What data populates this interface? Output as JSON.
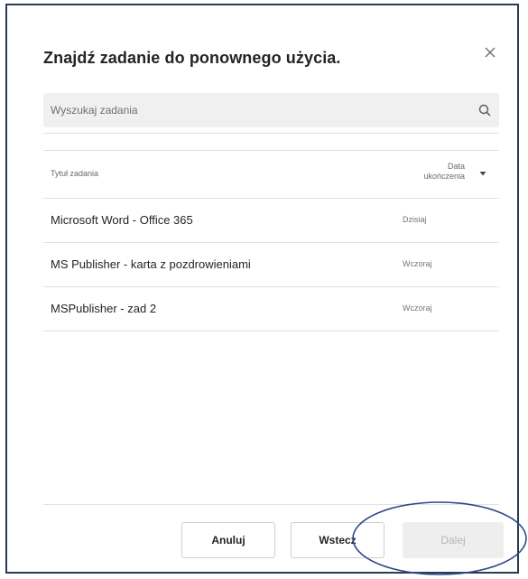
{
  "dialog": {
    "title": "Znajdź zadanie do ponownego użycia.",
    "close_icon": "close-icon"
  },
  "search": {
    "placeholder": "Wyszukaj zadania",
    "icon": "search-icon"
  },
  "table": {
    "columns": {
      "title": "Tytuł zadania",
      "date_line1": "Data",
      "date_line2": "ukończenia",
      "sort_icon": "caret-down-icon"
    },
    "rows": [
      {
        "name": "Microsoft Word - Office 365",
        "date": "Dzisiaj"
      },
      {
        "name": "MS Publisher - karta z pozdrowieniami",
        "date": "Wczoraj"
      },
      {
        "name": "MSPublisher - zad 2",
        "date": "Wczoraj"
      }
    ]
  },
  "footer": {
    "cancel_label": "Anuluj",
    "back_label": "Wstecz",
    "next_label": "Dalej"
  },
  "colors": {
    "frame_border": "#2b3a55",
    "annotation_ellipse": "#2e4a8a",
    "disabled_button_bg": "#eeeeee"
  }
}
